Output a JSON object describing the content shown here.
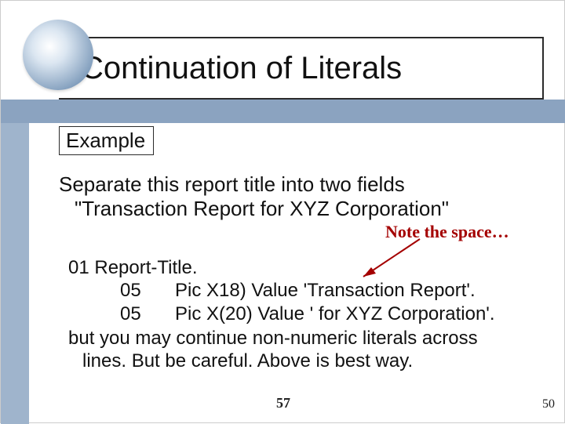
{
  "title": "Continuation of Literals",
  "example_label": "Example",
  "intro": {
    "line1": "Separate this report title into two fields",
    "line2": "\"Transaction Report for XYZ Corporation\""
  },
  "note_text": "Note the space…",
  "code": {
    "r1": "01  Report-Title.",
    "r2_level": "05",
    "r2_rest": "Pic X18)   Value 'Transaction Report'.",
    "r3_level": "05",
    "r3_rest": "Pic X(20)  Value ' for XYZ Corporation'.",
    "note_l1": "but you may continue non-numeric literals across",
    "note_l2": "lines.  But be careful.  Above is best way."
  },
  "footer": {
    "center": "57",
    "right": "50"
  }
}
